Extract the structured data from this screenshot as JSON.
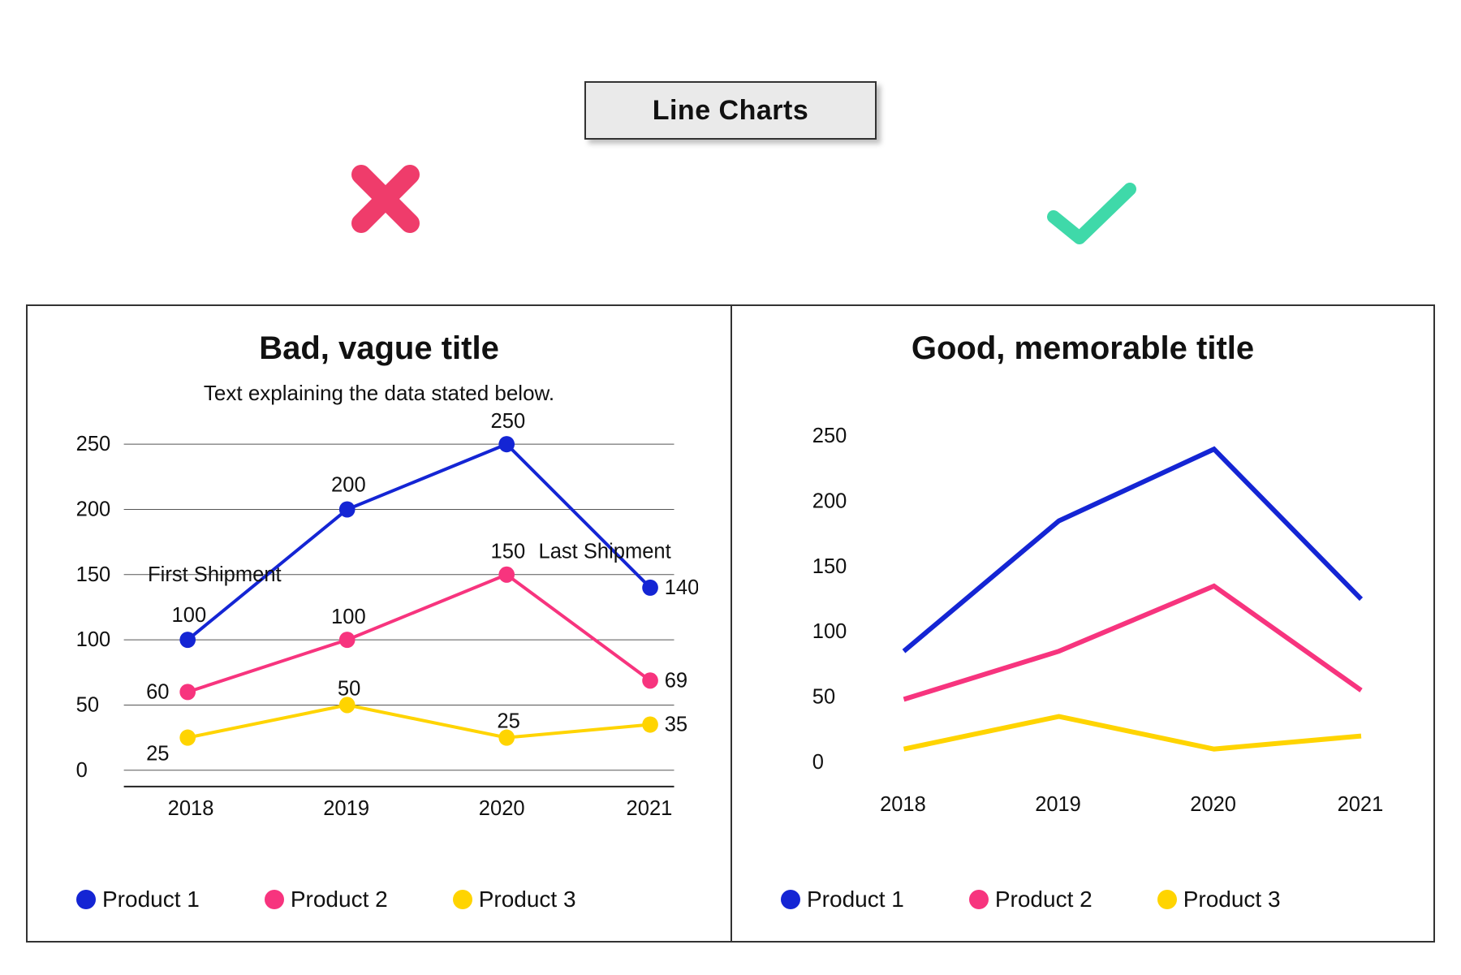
{
  "page_title": "Line Charts",
  "indicators": {
    "bad": {
      "symbol": "cross",
      "color": "#ef3c6b"
    },
    "good": {
      "symbol": "check",
      "color": "#3fd9a9"
    }
  },
  "colors": {
    "product1": "#1425d4",
    "product2": "#f7347e",
    "product3": "#ffd400"
  },
  "bad_panel": {
    "title": "Bad, vague title",
    "subtitle": "Text explaining the data stated below.",
    "annotations": {
      "first": "First Shipment",
      "last": "Last Shipment"
    },
    "y_ticks": [
      "0",
      "50",
      "100",
      "150",
      "200",
      "250"
    ],
    "x_ticks": [
      "2018",
      "2019",
      "2020",
      "2021"
    ],
    "legend": [
      "Product 1",
      "Product 2",
      "Product 3"
    ],
    "data_labels": {
      "p1": [
        "100",
        "200",
        "250",
        "140"
      ],
      "p2": [
        "60",
        "100",
        "150",
        "69"
      ],
      "p3": [
        "25",
        "50",
        "25",
        "35"
      ]
    }
  },
  "good_panel": {
    "title": "Good, memorable title",
    "y_ticks": [
      "0",
      "50",
      "100",
      "150",
      "200",
      "250"
    ],
    "x_ticks": [
      "2018",
      "2019",
      "2020",
      "2021"
    ],
    "legend": [
      "Product 1",
      "Product 2",
      "Product 3"
    ]
  },
  "chart_data": [
    {
      "type": "line",
      "title": "Bad, vague title",
      "subtitle": "Text explaining the data stated below.",
      "x": [
        2018,
        2019,
        2020,
        2021
      ],
      "series": [
        {
          "name": "Product 1",
          "values": [
            100,
            200,
            250,
            140
          ],
          "color": "#1425d4"
        },
        {
          "name": "Product 2",
          "values": [
            60,
            100,
            150,
            69
          ],
          "color": "#f7347e"
        },
        {
          "name": "Product 3",
          "values": [
            25,
            50,
            25,
            35
          ],
          "color": "#ffd400"
        }
      ],
      "ylim": [
        0,
        250
      ],
      "xlabel": "",
      "ylabel": "",
      "markers": true,
      "grid": true,
      "data_labels": true,
      "annotations": [
        {
          "text": "First Shipment",
          "x": 2018,
          "series": "Product 1"
        },
        {
          "text": "Last Shipment",
          "x": 2021,
          "series": "Product 1"
        }
      ]
    },
    {
      "type": "line",
      "title": "Good, memorable title",
      "x": [
        2018,
        2019,
        2020,
        2021
      ],
      "series": [
        {
          "name": "Product 1",
          "values": [
            85,
            185,
            240,
            125
          ],
          "color": "#1425d4"
        },
        {
          "name": "Product 2",
          "values": [
            48,
            85,
            135,
            55
          ],
          "color": "#f7347e"
        },
        {
          "name": "Product 3",
          "values": [
            10,
            35,
            10,
            20
          ],
          "color": "#ffd400"
        }
      ],
      "ylim": [
        0,
        250
      ],
      "xlabel": "",
      "ylabel": "",
      "markers": false,
      "grid": false,
      "data_labels": false
    }
  ]
}
